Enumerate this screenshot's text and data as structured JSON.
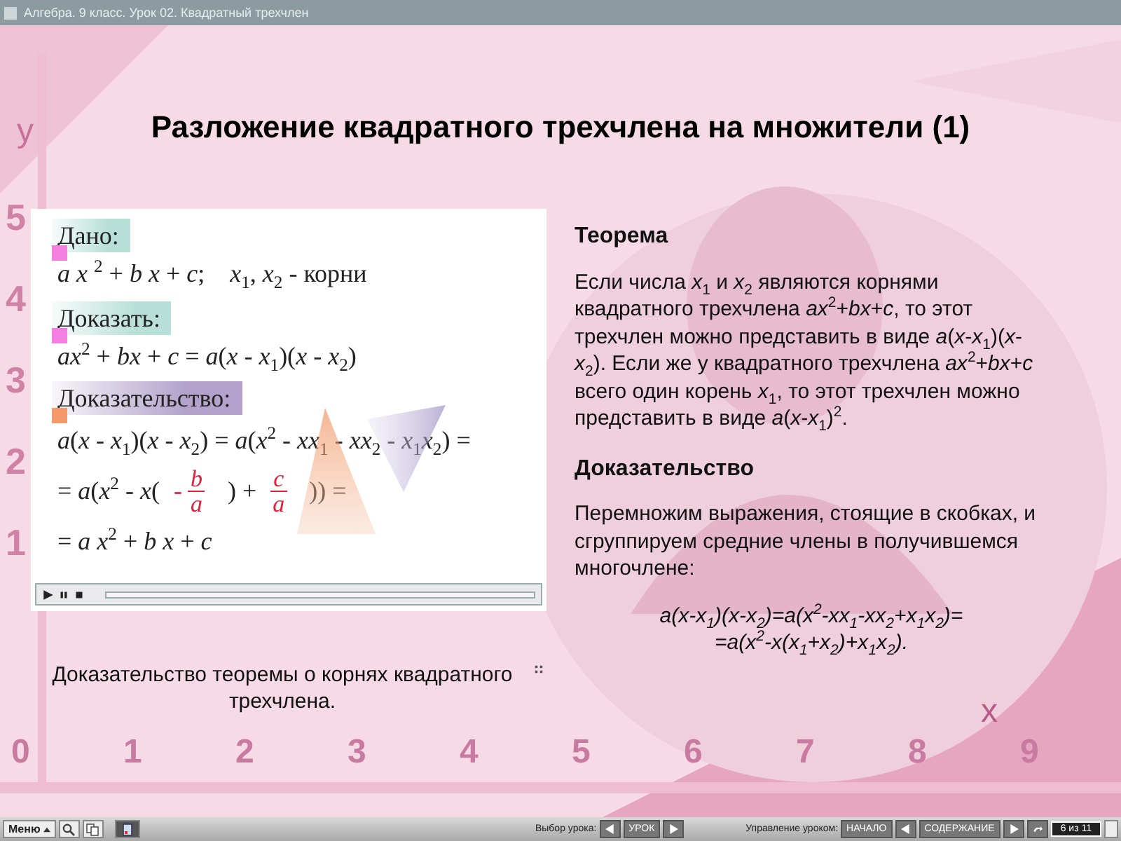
{
  "window": {
    "title": "Алгебра. 9 класс. Урок 02. Квадратный трехчлен"
  },
  "background": {
    "y_label": "y",
    "x_label": "x",
    "y_ticks": [
      "5",
      "4",
      "3",
      "2",
      "1"
    ],
    "x_ticks": [
      "0",
      "1",
      "2",
      "3",
      "4",
      "5",
      "6",
      "7",
      "8",
      "9"
    ]
  },
  "slide_title": "Разложение квадратного трехчлена на множители (1)",
  "proof_panel": {
    "sections": [
      {
        "label": "Дано:",
        "kind": "condition",
        "color": "#f57fe0",
        "lines": [
          [
            {
              "kind": "text",
              "text": "*a x* $^{2}$ + *b x* + *c*;    *x*$_{1}$, *x*$_{2}$ - корни"
            }
          ]
        ]
      },
      {
        "label": "Доказать:",
        "kind": "condition",
        "color": "#f57fe0",
        "lines": [
          [
            {
              "kind": "text",
              "text": "*ax*$^{2}$ + *bx* + *c* = *a*(*x* - *x*$_{1}$)(*x* - *x*$_{2}$)"
            }
          ]
        ]
      },
      {
        "label": "Доказательство:",
        "kind": "proof",
        "color": "#f5986a",
        "lines": [
          [
            {
              "kind": "text",
              "text": "*a*(*x* - *x*$_{1}$)(*x* - *x*$_{2}$) = *a*(*x*$^{2}$ - *xx*$_{1}$ - *xx*$_{2}$ - *x*$_{1}$*x*$_{2}$) ="
            }
          ],
          [
            {
              "kind": "text",
              "text": "= *a*(*x*$^{2}$ - *x*("
            },
            {
              "kind": "fraction",
              "sign": "-",
              "num": "b",
              "den": "a"
            },
            {
              "kind": "text",
              "text": ") +"
            },
            {
              "kind": "fraction",
              "num": "c",
              "den": "a"
            },
            {
              "kind": "text",
              "text": ")) ="
            }
          ],
          [
            {
              "kind": "text",
              "text": "= *a x*$^{2}$ + *b x* + *c*"
            }
          ]
        ]
      }
    ]
  },
  "caption": "Доказательство теоремы о корнях квадратного трехчлена.",
  "theorem": {
    "heading": "Теорема",
    "text": "Если числа *x*$_{1}$ и *x*$_{2}$ являются корнями квадратного трехчлена *ax*$^{2}$+*bx*+*c*, то этот трехчлен можно представить в виде *a*(*x*-*x*$_{1}$)(*x*-*x*$_{2}$). Если же у квадратного трехчлена *ax*$^{2}$+*bx*+*c* всего один корень *x*$_{1}$, то этот трехчлен можно представить в виде *a*(*x*-*x*$_{1}$)$^{2}$."
  },
  "proof": {
    "heading": "Доказательство",
    "text": "Перемножим выражения, стоящие в скобках, и сгруппируем средние члены в получившемся многочлене:",
    "formulas": [
      "*a*(*x*-*x*$_{1}$)(*x*-*x*$_{2}$)=*a*(*x*$^{2}$-*xx*$_{1}$-*xx*$_{2}$+*x*$_{1}$*x*$_{2}$)=",
      "=*a*(*x*$^{2}$-*x*(*x*$_{1}$+*x*$_{2}$)+*x*$_{1}$*x*$_{2}$)."
    ]
  },
  "toolbar": {
    "menu": "Меню",
    "lesson_label": "Выбор урока:",
    "lesson_button": "УРОК",
    "control_label": "Управление уроком:",
    "start_button": "НАЧАЛО",
    "contents_button": "СОДЕРЖАНИЕ",
    "page": "6 из 11"
  }
}
